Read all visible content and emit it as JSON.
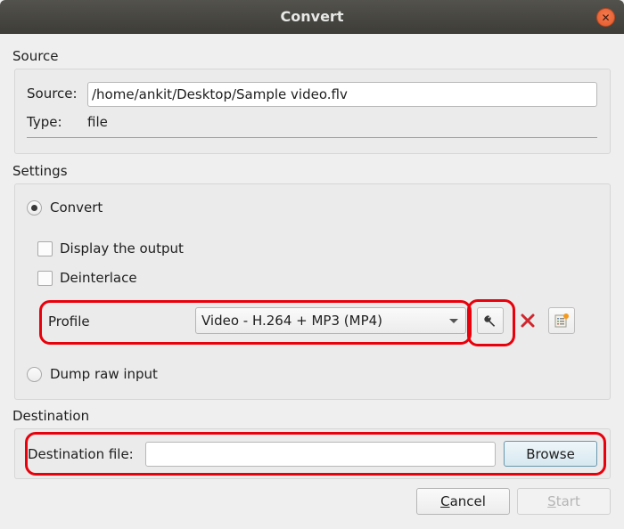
{
  "window": {
    "title": "Convert",
    "close_icon": "close-icon"
  },
  "source": {
    "section_label": "Source",
    "source_label": "Source:",
    "source_value": "/home/ankit/Desktop/Sample video.flv",
    "type_label": "Type:",
    "type_value": "file"
  },
  "settings": {
    "section_label": "Settings",
    "convert_radio": {
      "label": "Convert",
      "checked": true
    },
    "display_output": {
      "label": "Display the output",
      "checked": false
    },
    "deinterlace": {
      "label": "Deinterlace",
      "checked": false
    },
    "profile_label": "Profile",
    "profile_selected": "Video - H.264 + MP3 (MP4)",
    "edit_profile_icon": "wrench-icon",
    "delete_profile_icon": "delete-x-icon",
    "new_profile_icon": "new-profile-icon",
    "dump_raw_radio": {
      "label": "Dump raw input",
      "checked": false
    }
  },
  "destination": {
    "section_label": "Destination",
    "file_label": "Destination file:",
    "file_value": "",
    "browse_label": "Browse"
  },
  "footer": {
    "cancel_label": "Cancel",
    "cancel_mnemonic": "C",
    "cancel_rest": "ancel",
    "start_label": "Start",
    "start_mnemonic": "S",
    "start_rest": "tart",
    "start_enabled": false
  },
  "annotations": {
    "highlight_color": "#e8000b"
  }
}
